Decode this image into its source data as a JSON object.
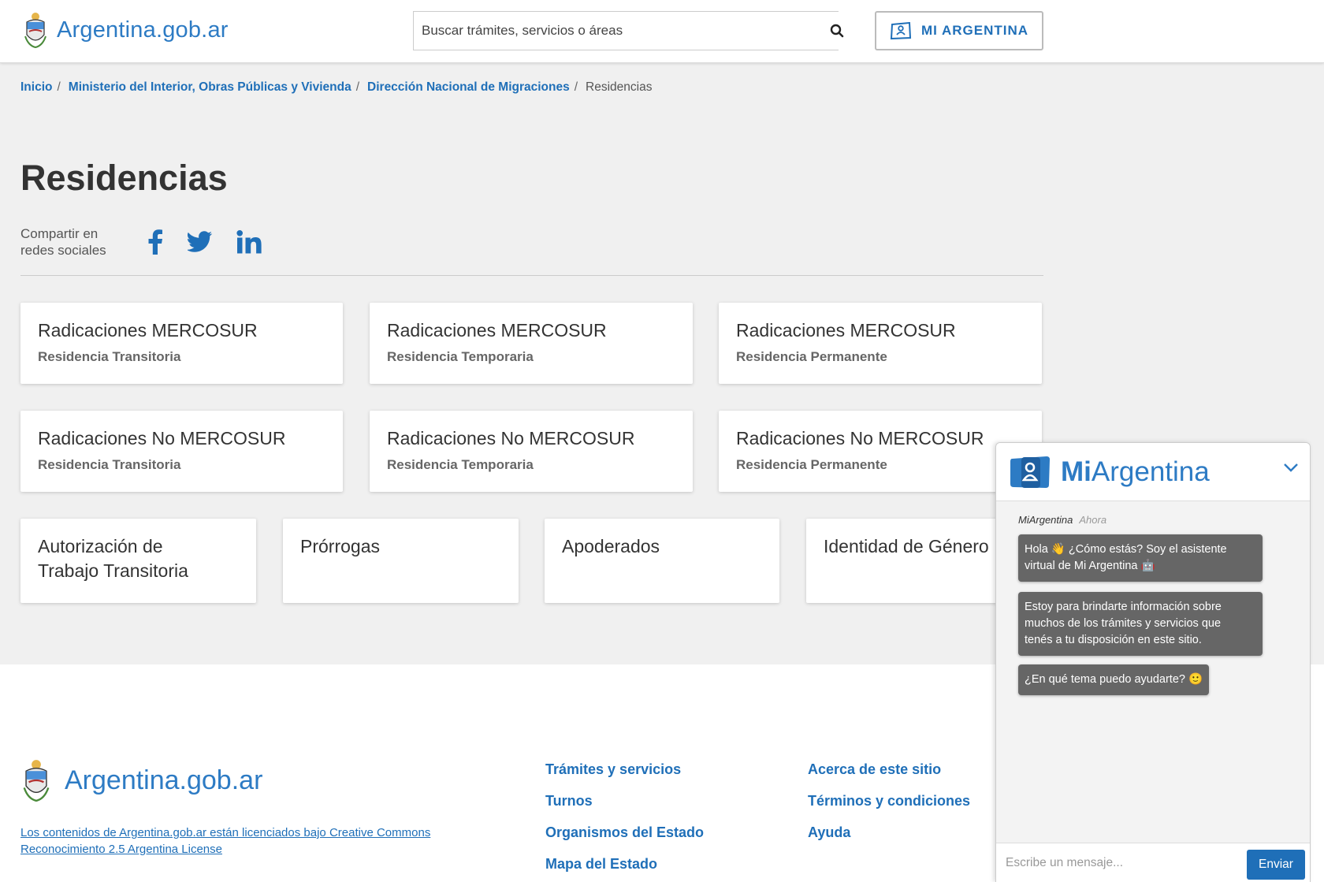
{
  "header": {
    "logo_text": "Argentina.gob.ar",
    "search_placeholder": "Buscar trámites, servicios o áreas",
    "mi_argentina_label": "MI ARGENTINA"
  },
  "breadcrumb": [
    {
      "label": "Inicio"
    },
    {
      "label": "Ministerio del Interior, Obras Públicas y Vivienda"
    },
    {
      "label": "Dirección Nacional de Migraciones"
    },
    {
      "label": "Residencias"
    }
  ],
  "page": {
    "title": "Residencias",
    "share_label_1": "Compartir en",
    "share_label_2": "redes sociales"
  },
  "cards": [
    {
      "title": "Radicaciones MERCOSUR",
      "subtitle": "Residencia Transitoria"
    },
    {
      "title": "Radicaciones MERCOSUR",
      "subtitle": "Residencia Temporaria"
    },
    {
      "title": "Radicaciones MERCOSUR",
      "subtitle": "Residencia Permanente"
    },
    {
      "title": "Radicaciones No MERCOSUR",
      "subtitle": "Residencia Transitoria"
    },
    {
      "title": "Radicaciones No MERCOSUR",
      "subtitle": "Residencia Temporaria"
    },
    {
      "title": "Radicaciones No MERCOSUR",
      "subtitle": "Residencia Permanente"
    },
    {
      "title_line1": "Autorización de",
      "title_line2": "Trabajo Transitoria"
    },
    {
      "title": "Prórrogas"
    },
    {
      "title": "Apoderados"
    },
    {
      "title": "Identidad de Género"
    }
  ],
  "footer": {
    "logo_text": "Argentina.gob.ar",
    "license_line1": "Los contenidos de Argentina.gob.ar están licenciados bajo Creative Commons",
    "license_line2": "Reconocimiento 2.5 Argentina License",
    "col1": [
      "Trámites y servicios",
      "Turnos",
      "Organismos del Estado",
      "Mapa del Estado"
    ],
    "col2": [
      "Acerca de este sitio",
      "Términos y condiciones",
      "Ayuda"
    ]
  },
  "chat": {
    "brand_bold": "Mi",
    "brand_rest": "Argentina",
    "sender": "MiArgentina",
    "time": "Ahora",
    "msg1_line1": "Hola 👋 ¿Cómo estás? Soy el asistente",
    "msg1_line2": "virtual de Mi Argentina 🤖",
    "msg2_line1": "Estoy para brindarte información sobre",
    "msg2_line2": "muchos de los trámites y servicios que",
    "msg2_line3": "tenés a tu disposición en este sitio.",
    "msg3": "¿En qué tema puedo ayudarte? 🙂",
    "input_placeholder": "Escribe un mensaje...",
    "send_label": "Enviar"
  },
  "colors": {
    "brand_blue": "#1f6fb8",
    "logo_blue": "#2d7bc4",
    "bubble_gray": "#666666",
    "page_bg": "#f0f0f0"
  }
}
